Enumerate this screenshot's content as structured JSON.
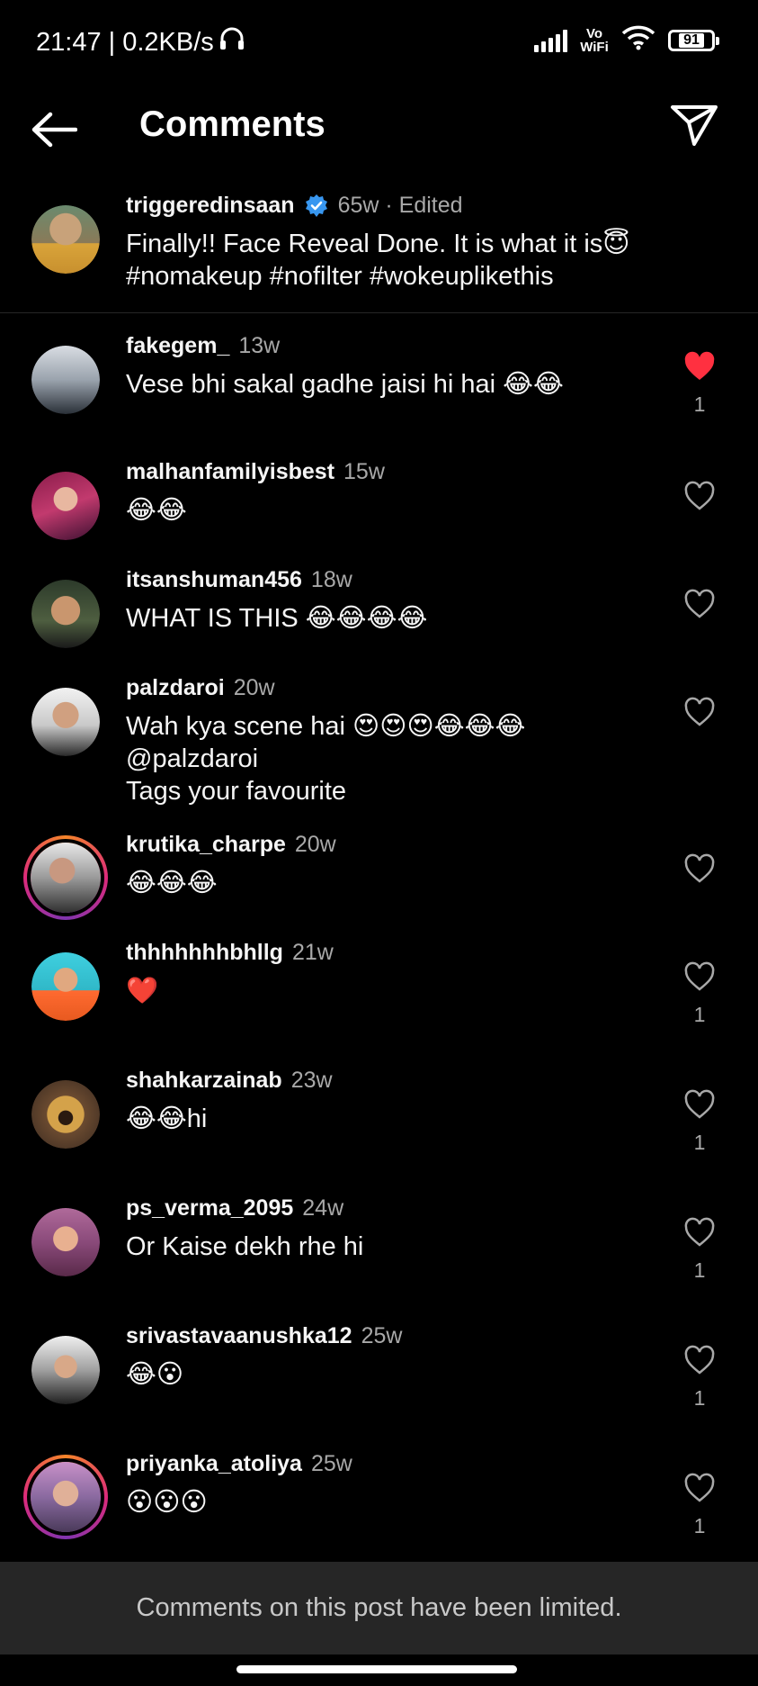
{
  "status_bar": {
    "time": "21:47 | 0.2KB/s",
    "network_label": "Vo WiFi",
    "battery": "91"
  },
  "header": {
    "title": "Comments",
    "back_icon": "back-arrow-icon",
    "send_icon": "send-icon"
  },
  "caption": {
    "username": "triggeredinsaan",
    "verified": true,
    "time": "65w · Edited",
    "text_line1": "Finally!! Face Reveal Done. It is what it is😇",
    "text_line2": "#nomakeup #nofilter #wokeuplikethis"
  },
  "comments": [
    {
      "username": "fakegem_",
      "time": "13w",
      "text": "Vese bhi sakal gadhe jaisi hi hai 😂😂",
      "liked": true,
      "likes": "1"
    },
    {
      "username": "malhanfamilyisbest",
      "time": "15w",
      "text": "😂😂",
      "liked": false,
      "likes": ""
    },
    {
      "username": "itsanshuman456",
      "time": "18w",
      "text": "WHAT IS THIS 😂😂😂😂",
      "liked": false,
      "likes": ""
    },
    {
      "username": "palzdaroi",
      "time": "20w",
      "text_line1": "Wah kya scene hai 😍😍😍😂😂😂",
      "text_line2": "@palzdaroi",
      "text_line3": "Tags your favourite",
      "liked": false,
      "likes": ""
    },
    {
      "username": "krutika_charpe",
      "time": "20w",
      "text": "😂😂😂",
      "liked": false,
      "likes": ""
    },
    {
      "username": "thhhhhhhbhllg",
      "time": "21w",
      "text": "❤️",
      "liked": false,
      "likes": "1"
    },
    {
      "username": "shahkarzainab",
      "time": "23w",
      "text": "😂😂hi",
      "liked": false,
      "likes": "1"
    },
    {
      "username": "ps_verma_2095",
      "time": "24w",
      "text": "Or Kaise dekh rhe hi",
      "liked": false,
      "likes": "1"
    },
    {
      "username": "srivastavaanushka12",
      "time": "25w",
      "text": "😂😮",
      "liked": false,
      "likes": "1"
    },
    {
      "username": "priyanka_atoliya",
      "time": "25w",
      "text": "😮😮😮",
      "liked": false,
      "likes": "1"
    }
  ],
  "footer": {
    "limited_message": "Comments on this post have been limited."
  },
  "colors": {
    "background": "#000000",
    "like_active": "#ff3040",
    "verified_blue": "#3897f0",
    "secondary_text": "#a8a8a8",
    "footer_bg": "#262626"
  }
}
